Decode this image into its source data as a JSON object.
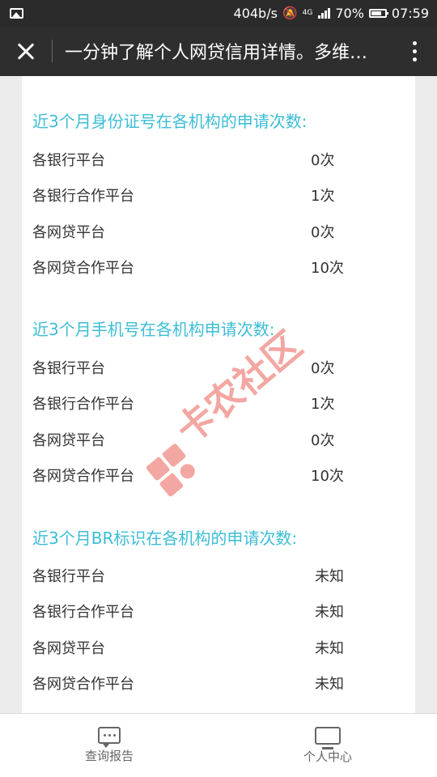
{
  "status_bar": {
    "speed": "404b/s",
    "network": "4G",
    "battery": "70%",
    "time": "07:59"
  },
  "nav": {
    "title": "一分钟了解个人网贷信用详情。多维…"
  },
  "sections": [
    {
      "title": "近3个月身份证号在各机构的申请次数:",
      "rows": [
        {
          "label": "各银行平台",
          "value": "0次"
        },
        {
          "label": "各银行合作平台",
          "value": "1次"
        },
        {
          "label": "各网贷平台",
          "value": "0次"
        },
        {
          "label": "各网贷合作平台",
          "value": "10次"
        }
      ]
    },
    {
      "title": "近3个月手机号在各机构申请次数:",
      "rows": [
        {
          "label": "各银行平台",
          "value": "0次"
        },
        {
          "label": "各银行合作平台",
          "value": "1次"
        },
        {
          "label": "各网贷平台",
          "value": "0次"
        },
        {
          "label": "各网贷合作平台",
          "value": "10次"
        }
      ]
    },
    {
      "title": "近3个月BR标识在各机构的申请次数:",
      "rows": [
        {
          "label": "各银行平台",
          "value": "未知"
        },
        {
          "label": "各银行合作平台",
          "value": "未知"
        },
        {
          "label": "各网贷平台",
          "value": "未知"
        },
        {
          "label": "各网贷合作平台",
          "value": "未知"
        }
      ]
    }
  ],
  "watermark": {
    "text": "卡农社区",
    "color": "#f08a84"
  },
  "tabs": [
    {
      "label": "查询报告",
      "icon": "chat-icon"
    },
    {
      "label": "个人中心",
      "icon": "monitor-icon"
    }
  ],
  "colors": {
    "accent": "#3bbdd6",
    "nav_bg": "#2e2e2e"
  }
}
